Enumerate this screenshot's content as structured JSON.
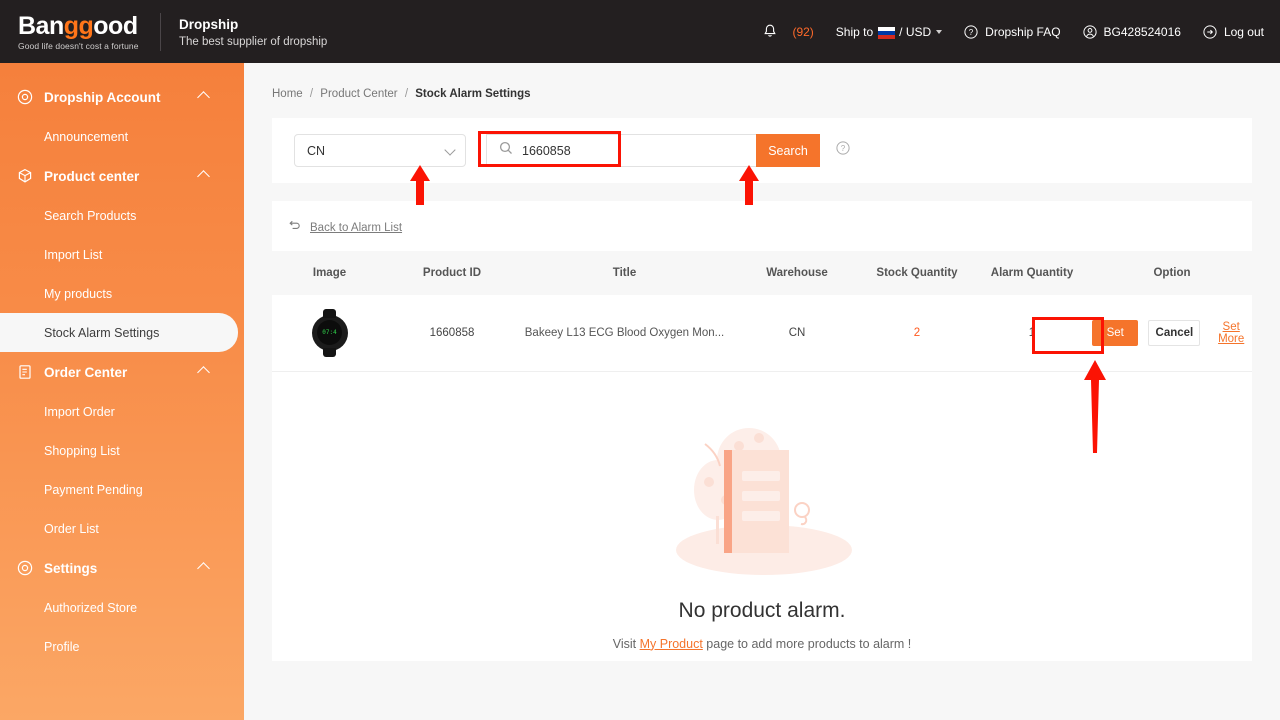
{
  "header": {
    "logo_main_a": "Ban",
    "logo_main_gg": "gg",
    "logo_main_b": "ood",
    "logo_tagline": "Good life doesn't cost a fortune",
    "dropship_title": "Dropship",
    "dropship_subtitle": "The best supplier of dropship",
    "bell_icon": "bell-icon",
    "notification_count": "(92)",
    "ship_to_label": "Ship to",
    "currency": "/ USD",
    "faq_icon": "question-circle-icon",
    "faq_label": "Dropship FAQ",
    "account_icon": "user-circle-icon",
    "account_id": "BG428524016",
    "logout_icon": "logout-icon",
    "logout_label": "Log out"
  },
  "sidebar": {
    "groups": [
      {
        "label": "Dropship Account",
        "icon": "target-icon",
        "items": [
          {
            "label": "Announcement",
            "active": false
          }
        ]
      },
      {
        "label": "Product center",
        "icon": "box-icon",
        "items": [
          {
            "label": "Search Products",
            "active": false
          },
          {
            "label": "Import List",
            "active": false
          },
          {
            "label": "My products",
            "active": false
          },
          {
            "label": "Stock Alarm Settings",
            "active": true
          }
        ]
      },
      {
        "label": "Order Center",
        "icon": "order-list-icon",
        "items": [
          {
            "label": "Import Order",
            "active": false
          },
          {
            "label": "Shopping List",
            "active": false
          },
          {
            "label": "Payment Pending",
            "active": false
          },
          {
            "label": "Order List",
            "active": false
          }
        ]
      },
      {
        "label": "Settings",
        "icon": "gear-icon",
        "items": [
          {
            "label": "Authorized Store",
            "active": false
          },
          {
            "label": "Profile",
            "active": false
          }
        ]
      }
    ]
  },
  "breadcrumb": {
    "home": "Home",
    "section": "Product Center",
    "current": "Stock Alarm Settings"
  },
  "search": {
    "warehouse_selected": "CN",
    "input_value": "1660858",
    "input_placeholder": "",
    "search_button": "Search",
    "help_icon": "question-circle-icon"
  },
  "table": {
    "back_link": "Back to Alarm List",
    "back_icon": "undo-arrow-icon",
    "columns": [
      "Image",
      "Product ID",
      "Title",
      "Warehouse",
      "Stock Quantity",
      "Alarm Quantity",
      "Option"
    ],
    "rows": [
      {
        "image_alt": "smartwatch-thumbnail",
        "watch_digits": "07:4",
        "product_id": "1660858",
        "title": "Bakeey L13 ECG Blood Oxygen Mon...",
        "warehouse": "CN",
        "stock_quantity": "2",
        "alarm_quantity": "1",
        "set_label": "Set",
        "cancel_label": "Cancel",
        "set_more_label": "Set More"
      }
    ]
  },
  "empty_state": {
    "title": "No product alarm.",
    "prefix": "Visit",
    "link": "My Product",
    "suffix": "page to add more products to alarm !"
  },
  "colors": {
    "brand_orange": "#f5742b",
    "sidebar_top": "#f5803c",
    "sidebar_bottom": "#fba765",
    "header_dark": "#231f20",
    "annotation_red": "#fb1304",
    "alarm_value": "#ff5a1f"
  }
}
